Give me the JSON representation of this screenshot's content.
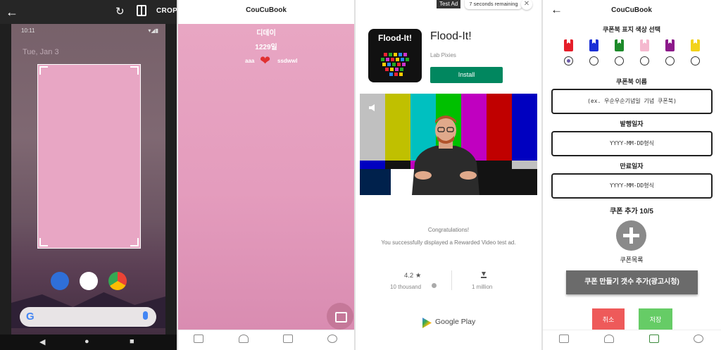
{
  "crop_screen": {
    "crop_label": "CROP",
    "status_time": "10:11",
    "status_right": "▾◢▮",
    "lock_date": "Tue, Jan 3",
    "search_logo": "G"
  },
  "couple_screen": {
    "app_title": "CouCuBook",
    "dday_label": "디데이",
    "dday_value": "1229일",
    "left_name": "aaa",
    "right_name": "ssdwwl"
  },
  "ad_screen": {
    "badge": "Test Ad",
    "timer": "7 seconds remaining",
    "icon_text": "Flood-It!",
    "app_name": "Flood-It!",
    "developer": "Lab Pixies",
    "install_label": "Install",
    "congrats": "Congratulations!",
    "message": "You successfully displayed a Rewarded Video test ad.",
    "rating": "4.2 ★",
    "reviews": "10 thousand",
    "downloads": "1 million",
    "store": "Google Play"
  },
  "coupon_form": {
    "app_title": "CouCuBook",
    "color_label": "쿠폰북 표지 색상 선택",
    "colors": [
      "#e51e2a",
      "#1a2fd6",
      "#1d8a2a",
      "#f5b9cf",
      "#8c1a8a",
      "#f2d21a"
    ],
    "selected_color_index": 0,
    "name_label": "쿠폰북 이름",
    "name_placeholder": "(ex. 우순우순기념일 기념 쿠폰북)",
    "issue_label": "발행일자",
    "issue_placeholder": "YYYY-MM-DD형식",
    "expire_label": "만료일자",
    "expire_placeholder": "YYYY-MM-DD형식",
    "coupon_count": "쿠폰 추가 10/5",
    "coupon_list_label": "쿠폰목록",
    "ad_button": "쿠폰 만들기 갯수 추가(광고시청)",
    "cancel": "취소",
    "save": "저장"
  }
}
